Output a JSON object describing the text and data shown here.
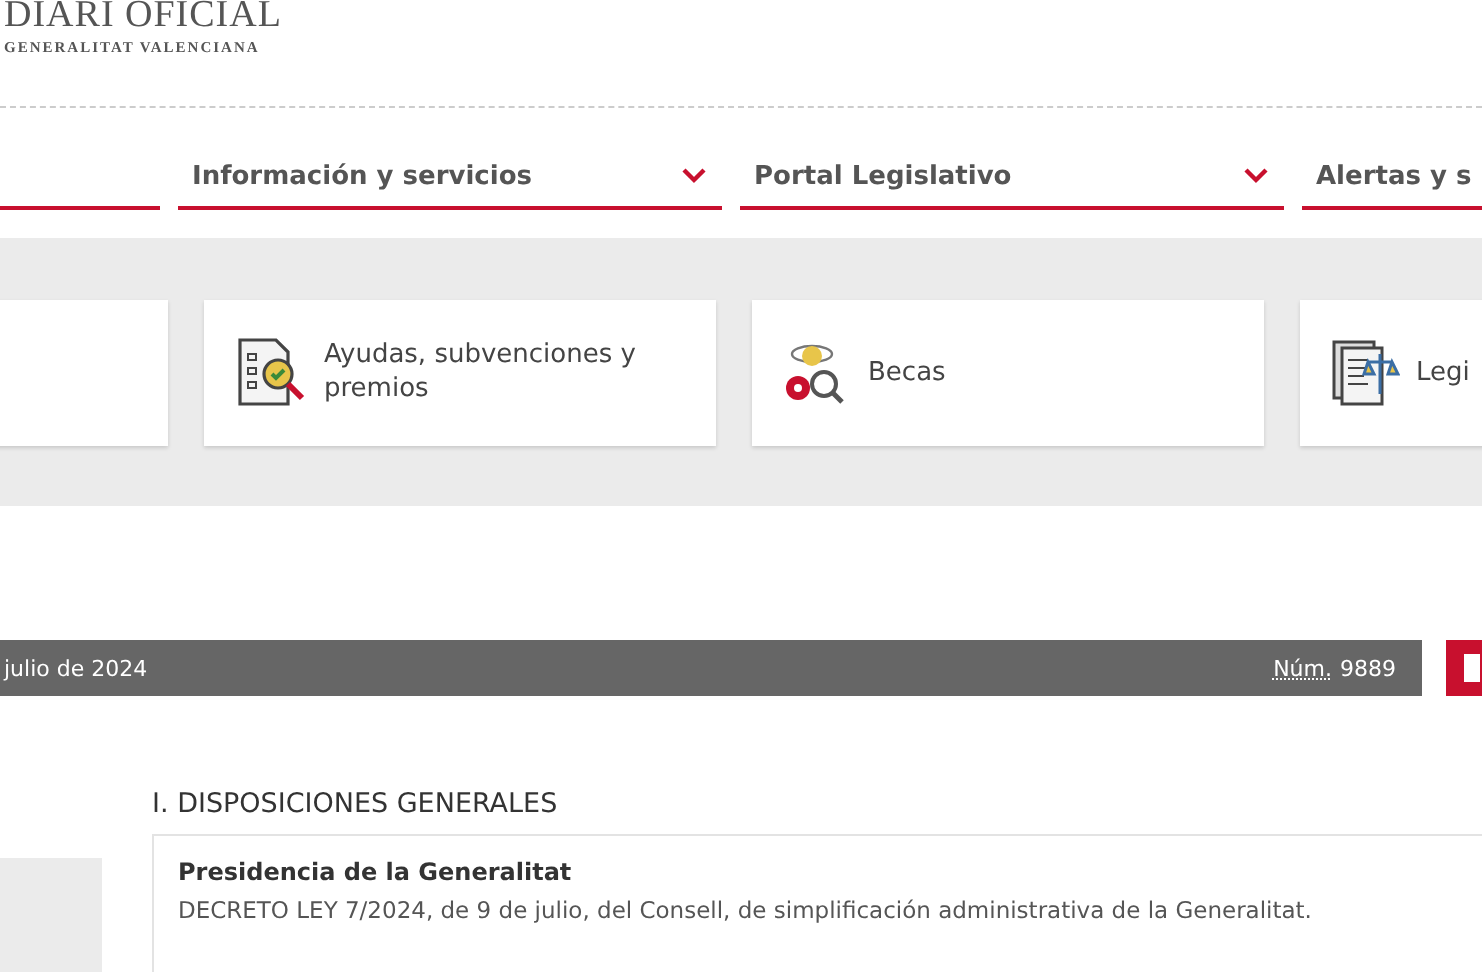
{
  "logo": {
    "title": "DIARI OFICIAL",
    "subtitle": "GENERALITAT VALENCIANA"
  },
  "nav": [
    {
      "label": "Información y servicios"
    },
    {
      "label": "Portal Legislativo"
    },
    {
      "label": "Alertas y s"
    }
  ],
  "cards": [
    {
      "label": "Ayudas, subvenciones y premios"
    },
    {
      "label": "Becas"
    },
    {
      "label": "Legi"
    }
  ],
  "issue_bar": {
    "date": "julio de 2024",
    "number_label": "Núm.",
    "number": "9889"
  },
  "section": {
    "title": "I. DISPOSICIONES GENERALES",
    "entries": [
      {
        "organ": "Presidencia de la Generalitat",
        "text": "DECRETO LEY 7/2024, de 9 de julio, del Consell, de simplificación administrativa de la Generalitat."
      }
    ]
  }
}
